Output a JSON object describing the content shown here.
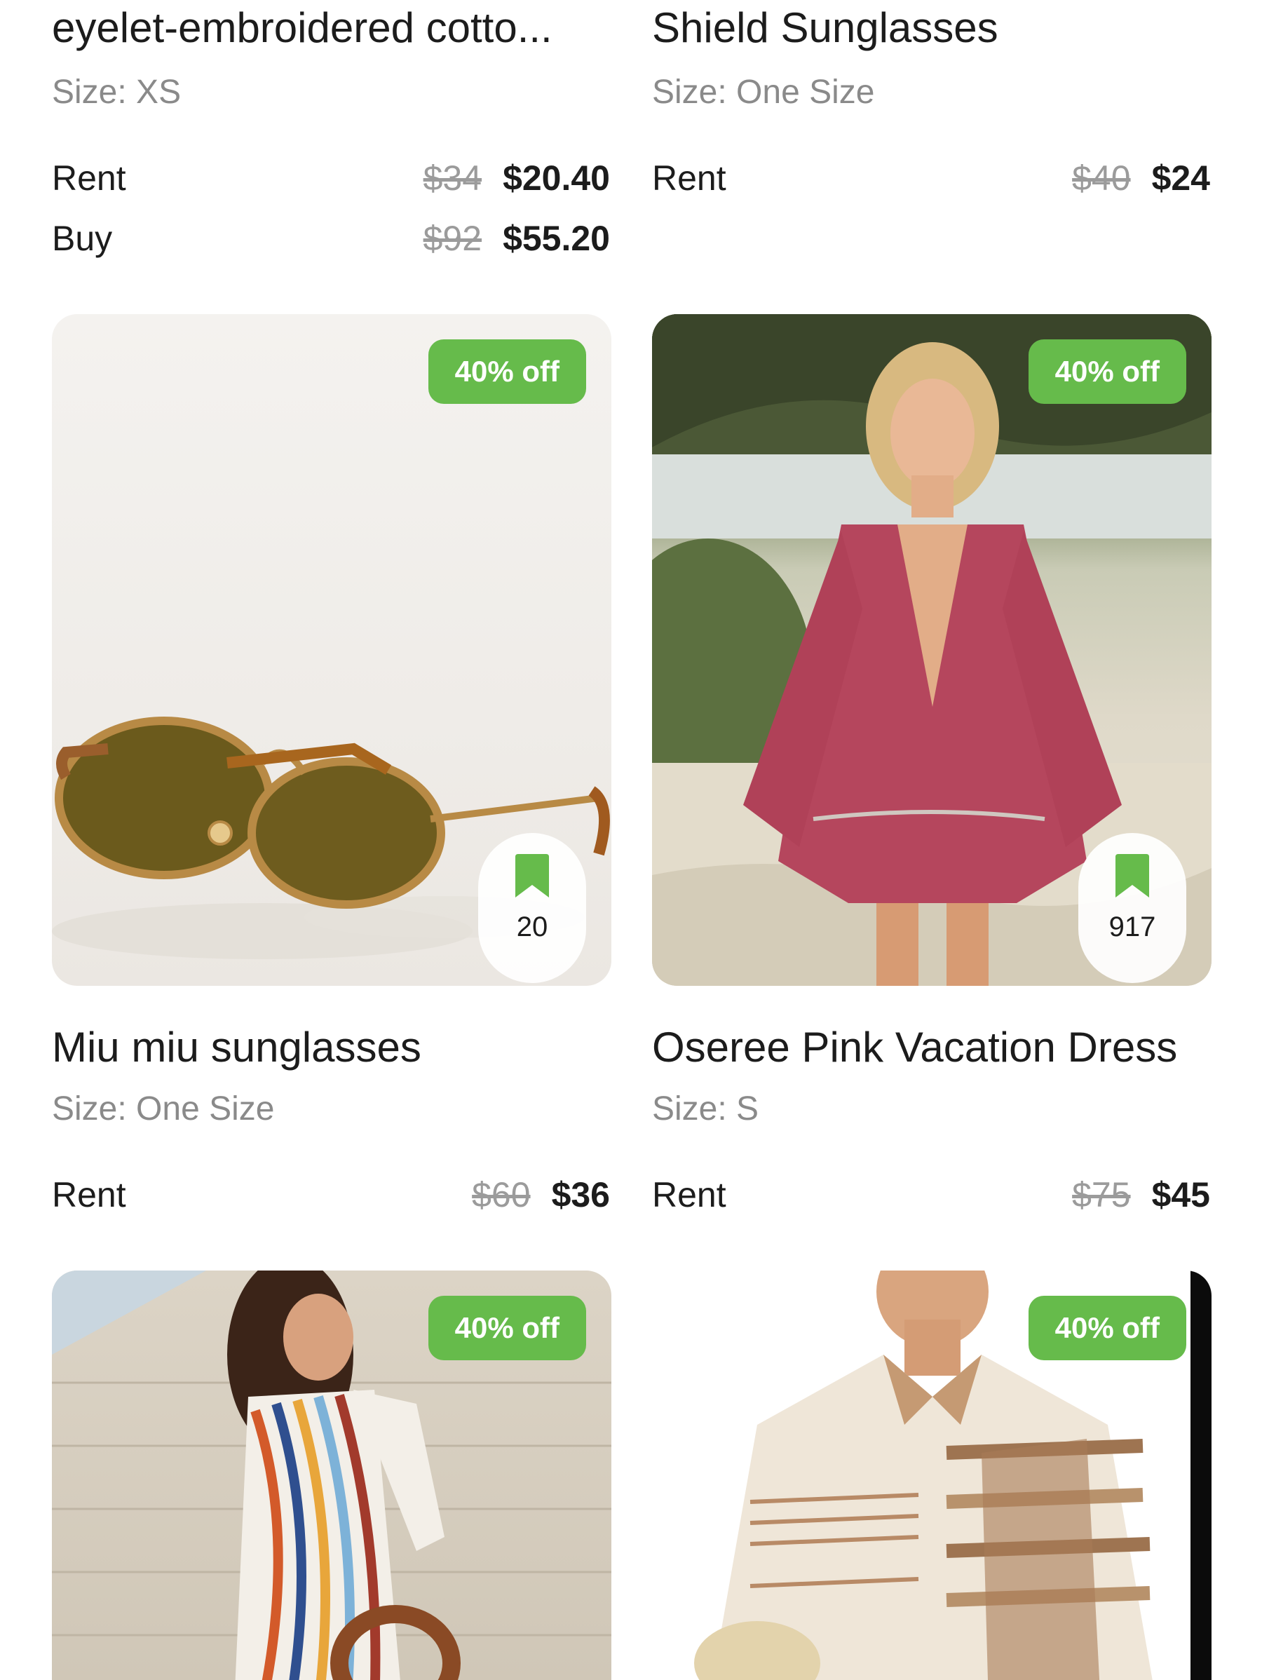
{
  "colors": {
    "badge_green": "#66bb4b",
    "bookmark_green": "#66bb4b",
    "muted_text": "#8a8a8a"
  },
  "products": [
    {
      "title": "eyelet-embroidered cotto...",
      "size": "Size: XS",
      "rent_label": "Rent",
      "rent_old": "$34",
      "rent_new": "$20.40",
      "buy_label": "Buy",
      "buy_old": "$92",
      "buy_new": "$55.20"
    },
    {
      "title": "Shield Sunglasses",
      "size": "Size: One Size",
      "rent_label": "Rent",
      "rent_old": "$40",
      "rent_new": "$24"
    },
    {
      "badge": "40% off",
      "bookmark_icon": "bookmark-icon",
      "saves": "20",
      "title": "Miu miu sunglasses",
      "size": "Size: One Size",
      "rent_label": "Rent",
      "rent_old": "$60",
      "rent_new": "$36"
    },
    {
      "badge": "40% off",
      "bookmark_icon": "bookmark-icon",
      "saves": "917",
      "title": "Oseree Pink Vacation Dress",
      "size": "Size: S",
      "rent_label": "Rent",
      "rent_old": "$75",
      "rent_new": "$45"
    },
    {
      "badge": "40% off"
    },
    {
      "badge": "40% off"
    }
  ]
}
